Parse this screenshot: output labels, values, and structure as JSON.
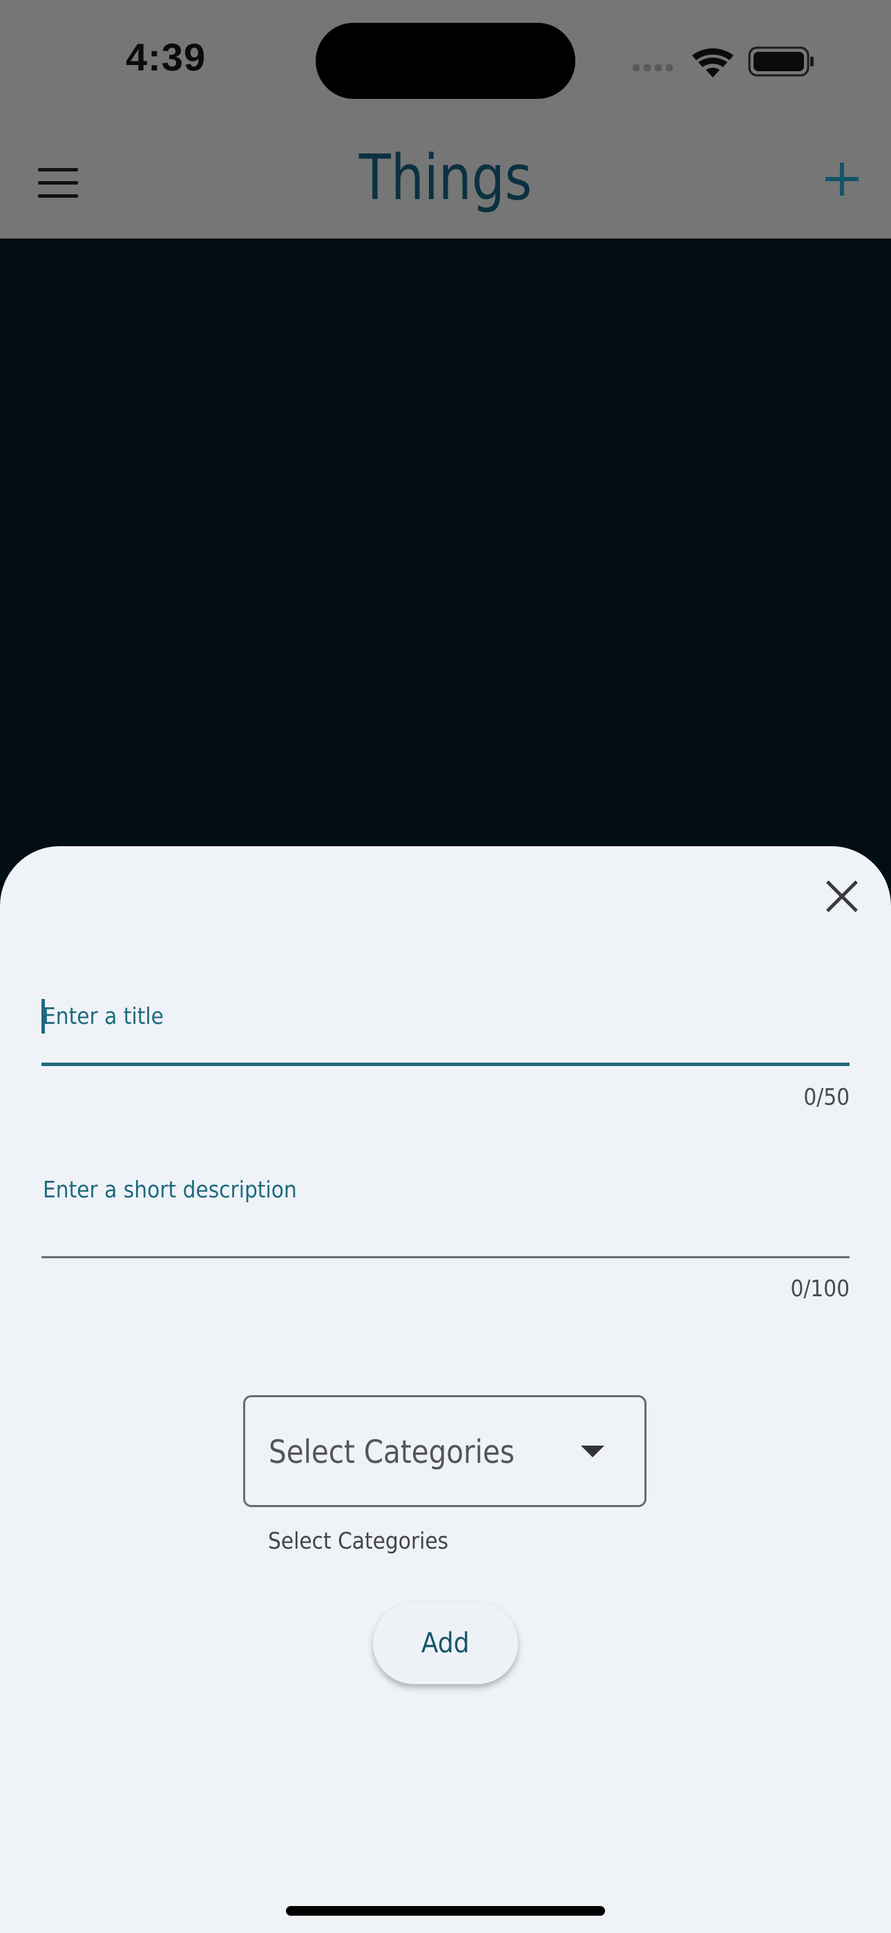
{
  "status_bar": {
    "time": "4:39"
  },
  "app_bar": {
    "title": "Things",
    "left_icon": "menu-icon",
    "right_icon": "plus-icon"
  },
  "sheet": {
    "close_icon": "close-icon",
    "title_field": {
      "placeholder": "Enter a title",
      "value": "",
      "counter": "0/50"
    },
    "description_field": {
      "placeholder": "Enter a short description",
      "value": "",
      "counter": "0/100"
    },
    "categories": {
      "selected": "Select Categories",
      "helper": "Select Categories"
    },
    "add_label": "Add"
  },
  "colors": {
    "accent": "#1f6a7d",
    "sheet_bg": "#eff3f8",
    "scrim": "#767676",
    "backdrop": "#020d14"
  }
}
